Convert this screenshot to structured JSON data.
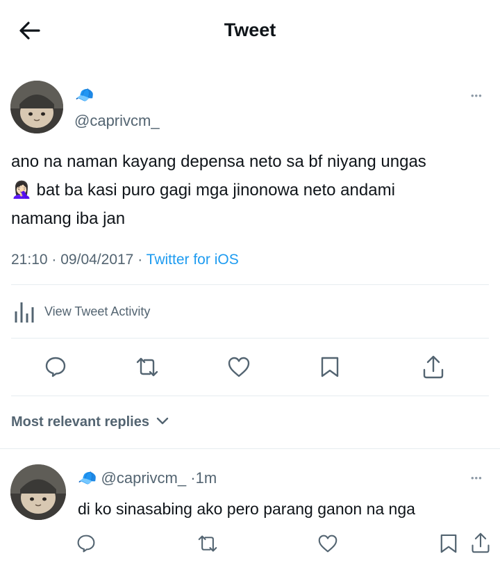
{
  "header": {
    "title": "Tweet"
  },
  "tweet": {
    "cap_emoji": "🧢",
    "handle": "@caprivcm_",
    "more": "•••",
    "text_line1": "ano na naman kayang depensa neto sa bf niyang ungas",
    "text_emoji": "🤦🏻‍♀️",
    "text_line2": " bat ba kasi puro gagi mga jinonowa neto andami",
    "text_line3": "namang iba jan",
    "time": "21:10",
    "date": "09/04/2017",
    "sep": "·",
    "source": "Twitter for iOS",
    "activity_label": "View Tweet Activity"
  },
  "replies_header": {
    "label": "Most relevant replies"
  },
  "reply": {
    "cap_emoji": "🧢",
    "handle": "@caprivcm_",
    "sep": "·",
    "age": "1m",
    "more": "•••",
    "text": "di ko sinasabing ako pero parang ganon na nga"
  },
  "colors": {
    "link": "#1d9bf0",
    "secondary": "#536471",
    "divider": "#e6ecf0"
  }
}
